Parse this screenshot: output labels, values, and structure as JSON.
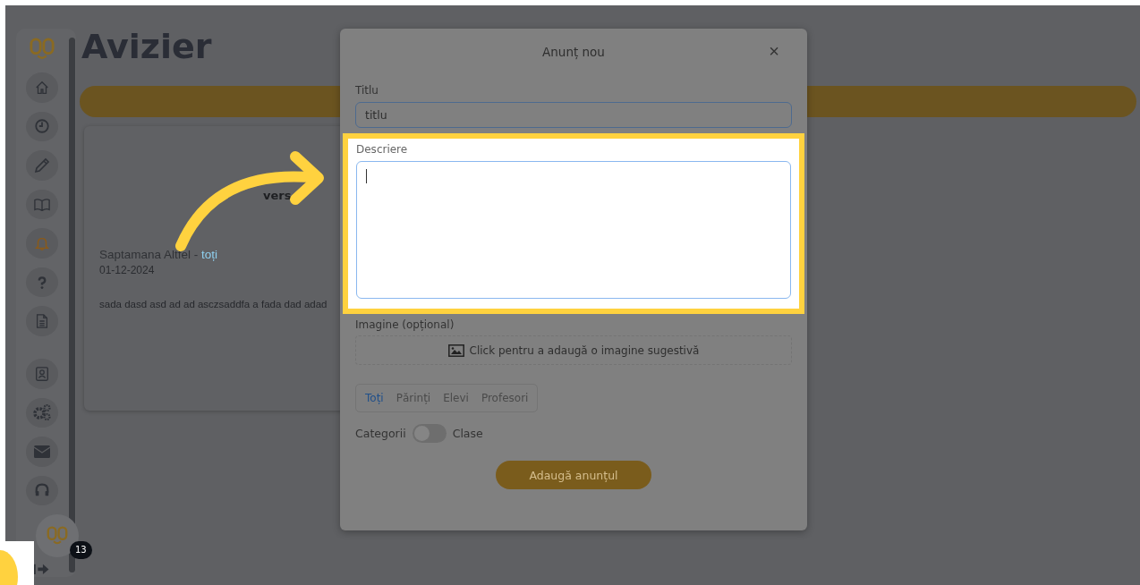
{
  "sidebar": {
    "items": [
      {
        "selected": false
      },
      {
        "selected": false
      },
      {
        "selected": false
      },
      {
        "selected": false
      },
      {
        "selected": true
      },
      {
        "selected": false
      },
      {
        "selected": false
      },
      {
        "selected": false
      },
      {
        "selected": false
      },
      {
        "selected": false
      },
      {
        "selected": false
      }
    ]
  },
  "page": {
    "title": "Avizier"
  },
  "announcement": {
    "header_fragment": "vers",
    "title": "Saptamana Altfel - ",
    "audience": "toți",
    "date": "01-12-2024",
    "text": "sada dasd asd ad ad asczsaddfa a fada dad adad"
  },
  "modal": {
    "title": "Anunț nou",
    "close": "×",
    "title_field": {
      "label": "Titlu",
      "value": "titlu"
    },
    "description_field": {
      "label": "Descriere",
      "highlighted": true
    },
    "image_field": {
      "label": "Imagine (opțional)",
      "prompt": "Click pentru a adaugă o imagine sugestivă"
    },
    "tabs": [
      {
        "label": "Toți",
        "selected": true
      },
      {
        "label": "Părinți",
        "selected": false
      },
      {
        "label": "Elevi",
        "selected": false
      },
      {
        "label": "Profesori",
        "selected": false
      }
    ],
    "toggle": {
      "left_label": "Categorii",
      "right_label": "Clase",
      "on": false
    },
    "submit": "Adaugă anunțul"
  },
  "chat": {
    "badge": "13"
  }
}
